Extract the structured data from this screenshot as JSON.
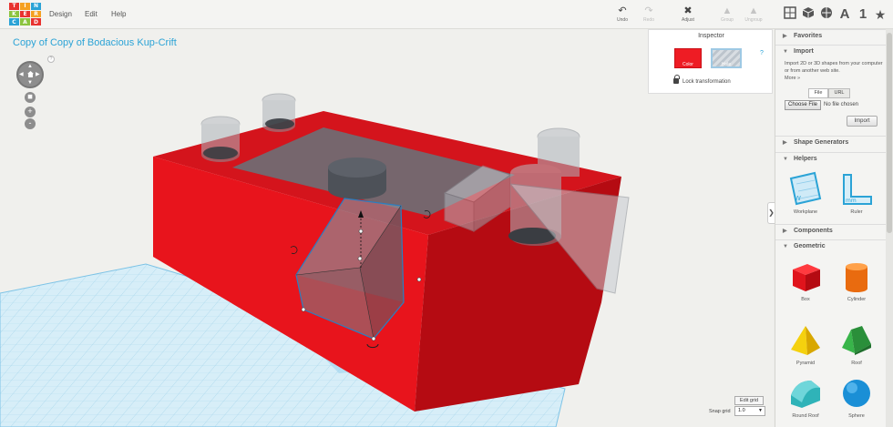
{
  "app": {
    "logo_letters": [
      "T",
      "I",
      "N",
      "K",
      "E",
      "R",
      "C",
      "A",
      "D"
    ],
    "logo_colors": [
      "#e8322f",
      "#f5a020",
      "#2ba3d6",
      "#8bc43f",
      "#e8322f",
      "#f5a020",
      "#2ba3d6",
      "#8bc43f",
      "#e8322f"
    ]
  },
  "menu": [
    "Design",
    "Edit",
    "Help"
  ],
  "toolbar": {
    "undo": "Undo",
    "redo": "Redo",
    "adjust": "Adjust",
    "group": "Group",
    "ungroup": "Ungroup"
  },
  "views": {
    "letter": "A",
    "number": "1"
  },
  "design_title": "Copy of Copy of Bodacious Kup-Crift",
  "navigation": {
    "help": "?",
    "zoom_in": "+",
    "zoom_out": "-"
  },
  "inspector": {
    "title": "Inspector",
    "color_label": "Color",
    "hole_label": "Hole",
    "help": "?",
    "lock_label": "Lock transformation",
    "selected_color": "#ee1c24"
  },
  "panel": {
    "favorites": "Favorites",
    "import": {
      "title": "Import",
      "description": "Import 2D or 3D shapes from your computer or from another web site.",
      "more": "More »",
      "tab_file": "File",
      "tab_url": "URL",
      "choose_file": "Choose File",
      "no_file": "No file chosen",
      "button": "Import"
    },
    "shape_generators": "Shape Generators",
    "helpers": {
      "title": "Helpers",
      "items": [
        "Workplane",
        "Ruler"
      ]
    },
    "components": "Components",
    "geometric": {
      "title": "Geometric",
      "items": [
        "Box",
        "Cylinder",
        "Pyramid",
        "Roof",
        "Round Roof",
        "Sphere"
      ]
    }
  },
  "bottom": {
    "edit_grid": "Edit grid",
    "snap_label": "Snap grid",
    "snap_value": "1.0"
  }
}
